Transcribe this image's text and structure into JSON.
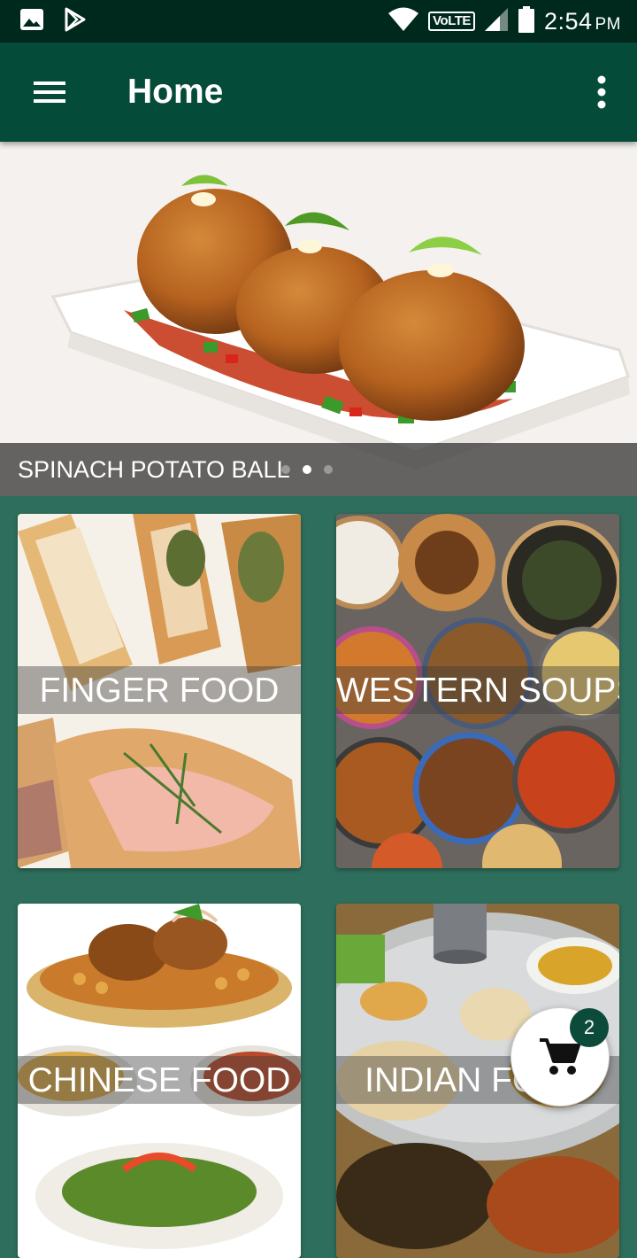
{
  "status_bar": {
    "network_label": "VoLTE",
    "time": "2:54",
    "ampm": "PM"
  },
  "app_bar": {
    "title": "Home"
  },
  "banner": {
    "caption": "SPINACH POTATO BALL",
    "slide_count": 3,
    "active_slide": 1
  },
  "categories": [
    {
      "label": "FINGER FOOD"
    },
    {
      "label": "WESTERN SOUPS"
    },
    {
      "label": "CHINESE FOOD"
    },
    {
      "label": "INDIAN FOOD"
    }
  ],
  "cart": {
    "count": "2"
  },
  "colors": {
    "app_bar": "#054b39",
    "status_bar": "#00291d",
    "background": "#2e6e5c",
    "badge": "#0c4a3a"
  }
}
